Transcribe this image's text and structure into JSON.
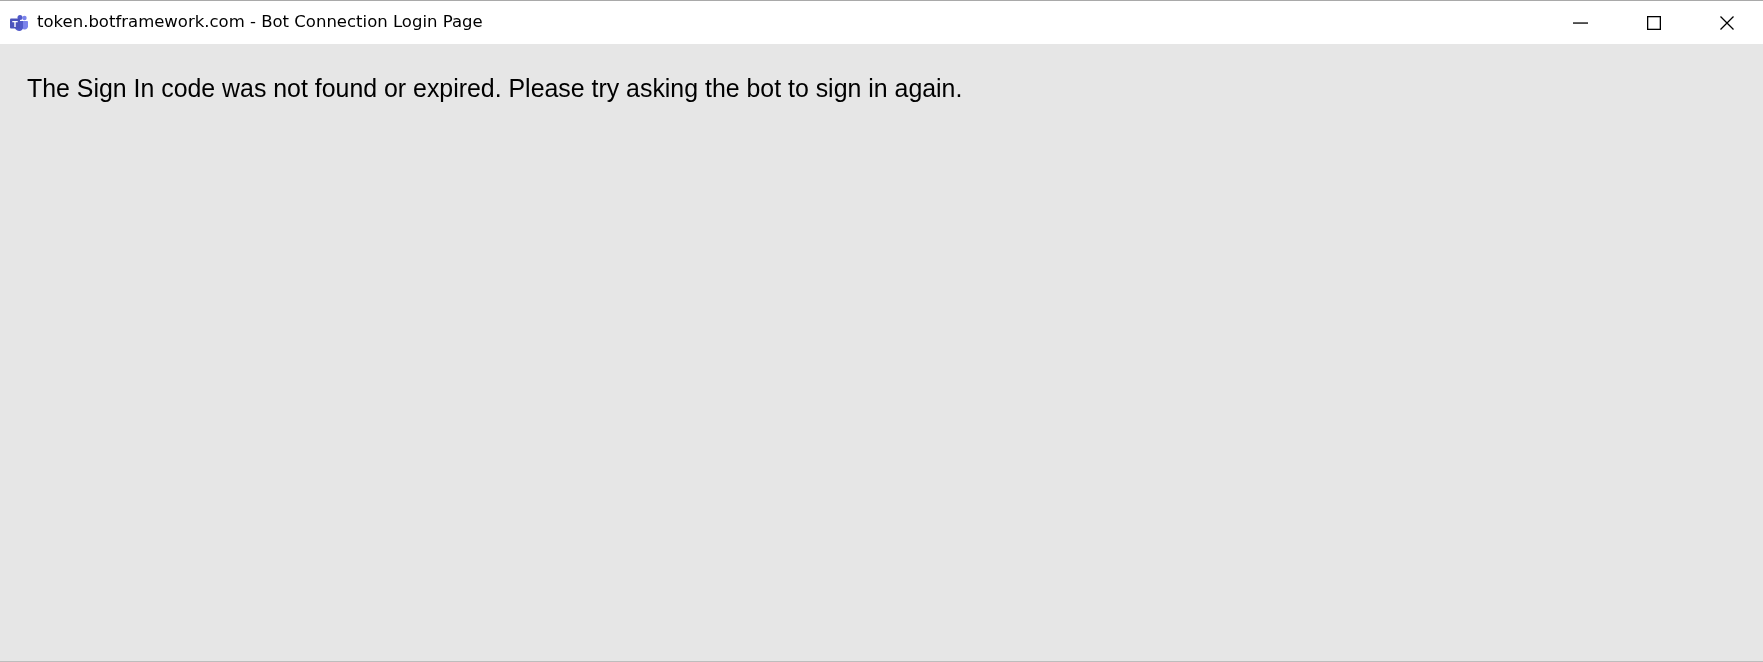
{
  "window": {
    "title": "token.botframework.com - Bot Connection Login Page"
  },
  "page": {
    "message": "The Sign In code was not found or expired. Please try asking the bot to sign in again."
  }
}
